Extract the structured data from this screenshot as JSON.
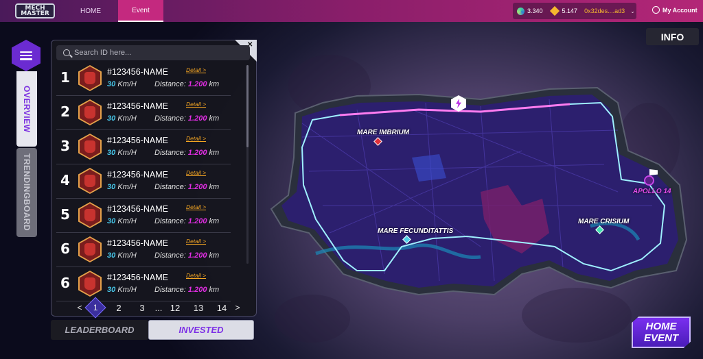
{
  "header": {
    "logo_text": "MECH MASTER",
    "nav": [
      {
        "label": "HOME"
      },
      {
        "label": "Event"
      }
    ],
    "wallet": {
      "balance_1": "3.340",
      "balance_2": "5.147",
      "address": "0x32des....ad3"
    },
    "account_label": "My Account"
  },
  "side_tabs": {
    "overview": "OVERVIEW",
    "trending": "TRENDINGBOARD"
  },
  "search": {
    "placeholder": "Search ID here..."
  },
  "leaderboard": {
    "rows": [
      {
        "rank": "1",
        "name": "#123456-NAME",
        "detail": "Detail >",
        "speed": "30",
        "speed_unit": "Km/H",
        "distance_label": "Distance:",
        "distance": "1.200",
        "distance_unit": "km"
      },
      {
        "rank": "2",
        "name": "#123456-NAME",
        "detail": "Detail >",
        "speed": "30",
        "speed_unit": "Km/H",
        "distance_label": "Distance:",
        "distance": "1.200",
        "distance_unit": "km"
      },
      {
        "rank": "3",
        "name": "#123456-NAME",
        "detail": "Detail >",
        "speed": "30",
        "speed_unit": "Km/H",
        "distance_label": "Distance:",
        "distance": "1.200",
        "distance_unit": "km"
      },
      {
        "rank": "4",
        "name": "#123456-NAME",
        "detail": "Detail >",
        "speed": "30",
        "speed_unit": "Km/H",
        "distance_label": "Distance:",
        "distance": "1.200",
        "distance_unit": "km"
      },
      {
        "rank": "5",
        "name": "#123456-NAME",
        "detail": "Detail >",
        "speed": "30",
        "speed_unit": "Km/H",
        "distance_label": "Distance:",
        "distance": "1.200",
        "distance_unit": "km"
      },
      {
        "rank": "6",
        "name": "#123456-NAME",
        "detail": "Detail >",
        "speed": "30",
        "speed_unit": "Km/H",
        "distance_label": "Distance:",
        "distance": "1.200",
        "distance_unit": "km"
      },
      {
        "rank": "6",
        "name": "#123456-NAME",
        "detail": "Detail >",
        "speed": "30",
        "speed_unit": "Km/H",
        "distance_label": "Distance:",
        "distance": "1.200",
        "distance_unit": "km"
      }
    ]
  },
  "pagination": {
    "prev": "<",
    "current": "1",
    "pages": [
      "2",
      "3"
    ],
    "ellipsis": "...",
    "pages_end": [
      "12",
      "13",
      "14"
    ],
    "next": ">"
  },
  "bottom_tabs": {
    "leaderboard": "LEADERBOARD",
    "invested": "INVESTED"
  },
  "info_label": "INFO",
  "map": {
    "locations": [
      {
        "label": "MARE IMBRIUM",
        "color": "#e0303a"
      },
      {
        "label": "MARE FECUNDITATTIS",
        "color": "#4fd0e6"
      },
      {
        "label": "MARE CRISIUM",
        "color": "#43e0b0"
      },
      {
        "label": "APOLLO 14",
        "color": "#e14be8"
      }
    ]
  },
  "home_event": {
    "line1": "HOME",
    "line2": "EVENT"
  },
  "colors": {
    "accent_purple": "#7a2ee0",
    "speed": "#47c6e8",
    "distance": "#e12ee3",
    "detail": "#f5a623"
  }
}
